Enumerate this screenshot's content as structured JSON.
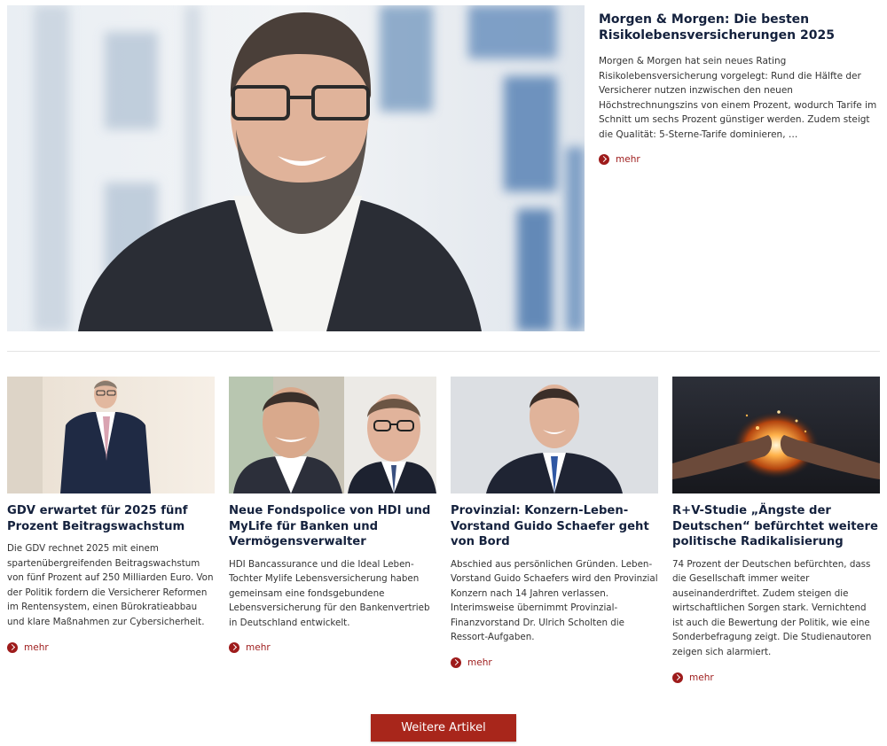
{
  "featured": {
    "title": "Morgen & Morgen: Die besten Risikolebensversicherungen 2025",
    "summary": "Morgen & Morgen hat sein neues Rating Risikolebensversicherung vorgelegt: Rund die Hälfte der Versicherer nutzen inzwischen den neuen Höchstrechnungszins von einem Prozent, wodurch Tarife im Schnitt um sechs Prozent günstiger werden. Zudem steigt die Qualität: 5-Sterne-Tarife dominieren, …",
    "more_label": "mehr"
  },
  "articles": [
    {
      "title": "GDV erwartet für 2025 fünf Prozent Beitragswachstum",
      "summary": "Die GDV rechnet 2025 mit einem spartenübergreifenden Beitragswachstum von fünf Prozent auf 250 Milliarden Euro. Von der Politik fordern die Versicherer Reformen im Rentensystem, einen Bürokratieabbau und klare Maßnahmen zur Cybersicherheit.",
      "more_label": "mehr"
    },
    {
      "title": "Neue Fondspolice von HDI und MyLife für Banken und Vermögensverwalter",
      "summary": "HDI Bancassurance und die Ideal Leben-Tochter Mylife Lebensversicherung haben gemeinsam eine fondsgebundene Lebensversicherung für den Bankenvertrieb in Deutschland entwickelt.",
      "more_label": "mehr"
    },
    {
      "title": "Provinzial: Konzern-Leben-Vorstand Guido Schaefer geht von Bord",
      "summary": "Abschied aus persönlichen Gründen. Leben-Vorstand Guido Schaefers wird den Provinzial Konzern nach 14 Jahren verlassen. Interimsweise übernimmt Provinzial-Finanzvorstand Dr. Ulrich Scholten die Ressort-Aufgaben.",
      "more_label": "mehr"
    },
    {
      "title": "R+V-Studie „Ängste der Deutschen“ befürchtet weitere politische Radikalisierung",
      "summary": "74 Prozent der Deutschen befürchten, dass die Gesellschaft immer weiter auseinanderdriftet. Zudem steigen die wirtschaftlichen Sorgen stark. Vernichtend ist auch die Bewertung der Politik, wie eine Sonderbefragung zeigt. Die Studienautoren zeigen sich alarmiert.",
      "more_label": "mehr"
    }
  ],
  "load_more_label": "Weitere Artikel",
  "colors": {
    "accent": "#a8261b",
    "title": "#14213d"
  }
}
